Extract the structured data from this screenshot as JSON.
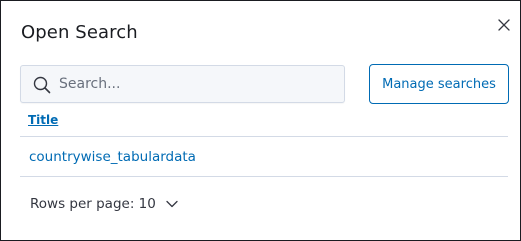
{
  "dialog": {
    "title": "Open Search",
    "close_icon": "close-icon"
  },
  "search": {
    "placeholder": "Search...",
    "value": "",
    "icon": "search-icon"
  },
  "manage_button": {
    "label": "Manage searches"
  },
  "table": {
    "columns": [
      "Title"
    ],
    "rows": [
      {
        "title": "countrywise_tabulardata"
      }
    ]
  },
  "pagination": {
    "rows_per_page_label": "Rows per page: 10",
    "icon": "chevron-down-icon"
  },
  "colors": {
    "accent": "#006bb4",
    "text": "#1a1c21",
    "border": "#d3dae6",
    "input_bg": "#f5f7fa"
  }
}
